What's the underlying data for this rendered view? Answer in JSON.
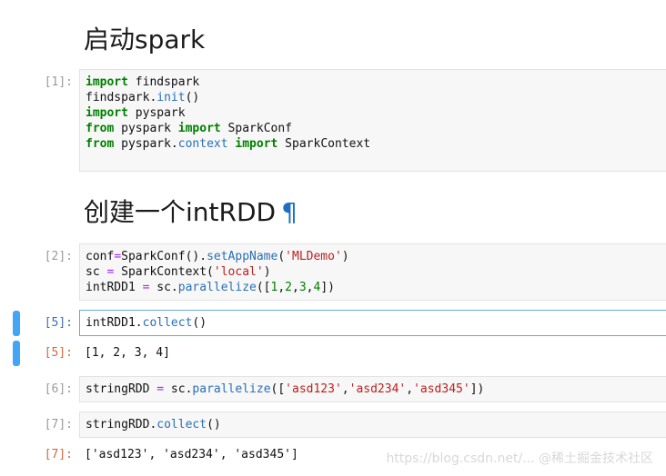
{
  "headings": {
    "start": "启动spark",
    "create": "创建一个intRDD",
    "pilcrow": "¶"
  },
  "cells": [
    {
      "prompt": "[1]:",
      "lines": [
        [
          {
            "t": "import",
            "c": "kw"
          },
          {
            "t": " findspark"
          }
        ],
        [
          {
            "t": "findspark"
          },
          {
            "t": "."
          },
          {
            "t": "init",
            "c": "fn"
          },
          {
            "t": "()"
          }
        ],
        [
          {
            "t": "import",
            "c": "kw"
          },
          {
            "t": " pyspark"
          }
        ],
        [
          {
            "t": "from",
            "c": "kw"
          },
          {
            "t": " pyspark "
          },
          {
            "t": "import",
            "c": "kw"
          },
          {
            "t": " SparkConf"
          }
        ],
        [
          {
            "t": "from",
            "c": "kw"
          },
          {
            "t": " pyspark."
          },
          {
            "t": "context",
            "c": "fn"
          },
          {
            "t": " "
          },
          {
            "t": "import",
            "c": "kw"
          },
          {
            "t": " SparkContext"
          }
        ]
      ]
    },
    {
      "prompt": "[2]:",
      "lines": [
        [
          {
            "t": "conf"
          },
          {
            "t": "=",
            "c": "op"
          },
          {
            "t": "SparkConf()."
          },
          {
            "t": "setAppName",
            "c": "fn"
          },
          {
            "t": "("
          },
          {
            "t": "'MLDemo'",
            "c": "str"
          },
          {
            "t": ")"
          }
        ],
        [
          {
            "t": "sc "
          },
          {
            "t": "=",
            "c": "op"
          },
          {
            "t": " SparkContext("
          },
          {
            "t": "'local'",
            "c": "str"
          },
          {
            "t": ")"
          }
        ],
        [
          {
            "t": "intRDD1 "
          },
          {
            "t": "=",
            "c": "op"
          },
          {
            "t": " sc."
          },
          {
            "t": "parallelize",
            "c": "fn"
          },
          {
            "t": "(["
          },
          {
            "t": "1",
            "c": "num"
          },
          {
            "t": ","
          },
          {
            "t": "2",
            "c": "num"
          },
          {
            "t": ","
          },
          {
            "t": "3",
            "c": "num"
          },
          {
            "t": ","
          },
          {
            "t": "4",
            "c": "num"
          },
          {
            "t": "])"
          }
        ]
      ]
    },
    {
      "prompt": "[5]:",
      "lines": [
        [
          {
            "t": "intRDD1."
          },
          {
            "t": "collect",
            "c": "fn"
          },
          {
            "t": "()"
          }
        ]
      ]
    },
    {
      "prompt": "[6]:",
      "lines": [
        [
          {
            "t": "stringRDD "
          },
          {
            "t": "=",
            "c": "op"
          },
          {
            "t": " sc."
          },
          {
            "t": "parallelize",
            "c": "fn"
          },
          {
            "t": "(["
          },
          {
            "t": "'asd123'",
            "c": "str"
          },
          {
            "t": ","
          },
          {
            "t": "'asd234'",
            "c": "str"
          },
          {
            "t": ","
          },
          {
            "t": "'asd345'",
            "c": "str"
          },
          {
            "t": "])"
          }
        ]
      ]
    },
    {
      "prompt": "[7]:",
      "lines": [
        [
          {
            "t": "stringRDD."
          },
          {
            "t": "collect",
            "c": "fn"
          },
          {
            "t": "()"
          }
        ]
      ]
    }
  ],
  "outputs": [
    {
      "prompt": "[5]:",
      "text": "[1, 2, 3, 4]"
    },
    {
      "prompt": "[7]:",
      "text": "['asd123', 'asd234', 'asd345']"
    }
  ],
  "watermark": "https://blog.csdn.net/... @稀土掘金技术社区",
  "colors": {
    "keyword": "#008000",
    "function": "#2a6fb5",
    "string": "#ba2121",
    "operator": "#aa22ff",
    "active_border": "#66a9d9",
    "selection_bar": "#42a5f5",
    "output_prompt": "#d36a3c"
  }
}
